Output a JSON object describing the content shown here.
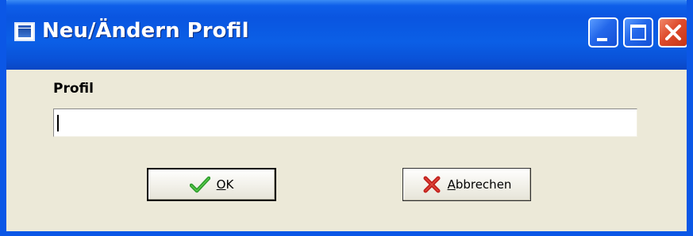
{
  "window": {
    "title": "Neu/Ändern Profil",
    "icon": "window-app-icon",
    "controls": {
      "minimize_icon": "minimize-icon",
      "maximize_icon": "maximize-icon",
      "close_icon": "close-icon"
    }
  },
  "form": {
    "profil_label": "Profil",
    "profil_value": "",
    "profil_placeholder": ""
  },
  "buttons": {
    "ok": {
      "label_underlined": "O",
      "label_rest": "K",
      "icon": "checkmark-icon"
    },
    "cancel": {
      "label_underlined": "A",
      "label_rest": "bbrechen",
      "icon": "red-x-icon"
    }
  },
  "colors": {
    "titlebar": "#0b57e6",
    "dialog_background": "#ece9d8",
    "ok_check": "#2a9a2a",
    "cancel_x": "#c0201c",
    "close_button": "#de4b2c"
  }
}
